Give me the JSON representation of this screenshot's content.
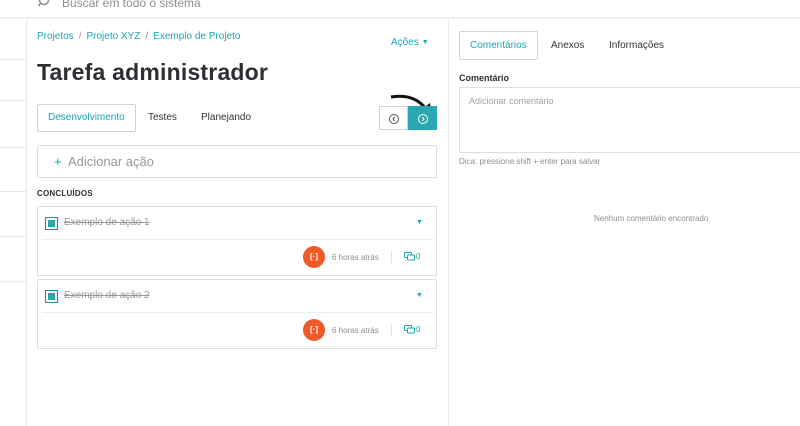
{
  "topbar": {
    "search_placeholder": "Buscar em todo o sistema"
  },
  "breadcrumb": [
    "Projetos",
    "Projeto XYZ",
    "Exemplo de Projeto"
  ],
  "actions_label": "Ações",
  "task_title": "Tarefa administrador",
  "tabs": [
    {
      "label": "Desenvolvimento",
      "active": true
    },
    {
      "label": "Testes",
      "active": false
    },
    {
      "label": "Planejando",
      "active": false
    }
  ],
  "add_action": {
    "plus": "+",
    "label": "Adicionar ação"
  },
  "section_label": "CONCLUÍDOS",
  "actions": [
    {
      "name": "Exemplo de ação 1",
      "avatar": "[·]",
      "time": "6 horas atrás",
      "comments": "0"
    },
    {
      "name": "Exemplo de ação 2",
      "avatar": "[·]",
      "time": "6 horas atrás",
      "comments": "0"
    }
  ],
  "right_tabs": [
    {
      "label": "Comentários",
      "active": true
    },
    {
      "label": "Anexos",
      "active": false
    },
    {
      "label": "Informações",
      "active": false
    }
  ],
  "comment": {
    "label": "Comentário",
    "placeholder": "Adicionar comentário",
    "hint": "Dica: pressione shift + enter para salvar",
    "empty": "Nenhum comentário encontrado"
  },
  "colors": {
    "accent": "#1aa6b7",
    "button_active": "#2aa8b1",
    "avatar": "#f05a28"
  },
  "icons": [
    "search-icon",
    "history-icon",
    "next-icon",
    "caret-down-icon",
    "comment-icon",
    "checkbox-icon",
    "arrow-annotation"
  ]
}
